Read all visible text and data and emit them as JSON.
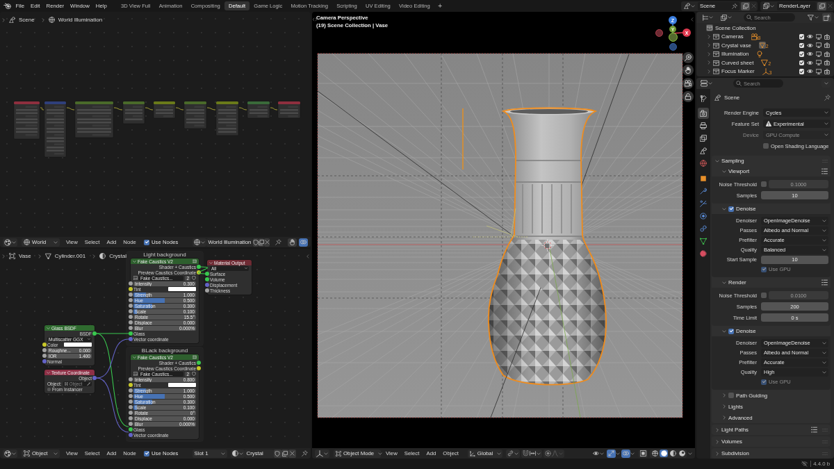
{
  "top_bar": {
    "menus": [
      "File",
      "Edit",
      "Render",
      "Window",
      "Help"
    ],
    "workspaces": [
      {
        "label": "3D View Full",
        "selected": false
      },
      {
        "label": "Animation",
        "selected": false
      },
      {
        "label": "Compositing",
        "selected": false
      },
      {
        "label": "Default",
        "selected": true
      },
      {
        "label": "Game Logic",
        "selected": false
      },
      {
        "label": "Motion Tracking",
        "selected": false
      },
      {
        "label": "Scripting",
        "selected": false
      },
      {
        "label": "UV Editing",
        "selected": false
      },
      {
        "label": "Video Editing",
        "selected": false
      }
    ],
    "add_workspace": "+",
    "scene": "Scene",
    "view_layer": "RenderLayer"
  },
  "world_editor": {
    "breadcrumb": [
      {
        "kind": "scene",
        "label": "Scene"
      },
      {
        "kind": "world",
        "label": "World Illumination"
      }
    ],
    "header": {
      "data_type": {
        "kind": "world",
        "label": "World"
      },
      "menus": [
        "View",
        "Select",
        "Add",
        "Node"
      ],
      "use_nodes": {
        "label": "Use Nodes",
        "checked": true
      },
      "datablock": {
        "kind": "world",
        "label": "World Illumination"
      },
      "toggles": [
        {
          "selected": false
        },
        {
          "selected": true
        }
      ]
    }
  },
  "material_editor": {
    "breadcrumb": [
      {
        "kind": "object",
        "label": "Vase"
      },
      {
        "kind": "mesh",
        "label": "Cylinder.001"
      },
      {
        "kind": "material",
        "label": "Crystal"
      }
    ],
    "frames": [
      {
        "label": "Light background",
        "node": {
          "title": "Fake Caustics V2",
          "outputs": [
            {
              "label": "Shader + Caustics",
              "color": "#39c84f"
            },
            {
              "label": "Preview Caustics Coordinate",
              "color": "#c7c729"
            }
          ],
          "image": {
            "name": "Fake Caustics...",
            "users": "2"
          },
          "inputs": [
            {
              "kind": "number",
              "label": "Intensity",
              "value": "0.300",
              "color": "#a1a1a1"
            },
            {
              "kind": "color",
              "label": "Tint",
              "color": "#c7c729"
            },
            {
              "kind": "slider",
              "label": "Strength",
              "value": "1.000",
              "level": 0.2,
              "color": "#a1a1a1"
            },
            {
              "kind": "slider",
              "label": "Hue",
              "value": "0.500",
              "level": 0.5,
              "color": "#a1a1a1"
            },
            {
              "kind": "slider",
              "label": "Saturation",
              "value": "0.300",
              "level": 0.3,
              "color": "#a1a1a1"
            },
            {
              "kind": "slider",
              "label": "Scale",
              "value": "0.100",
              "level": 0.06,
              "color": "#a1a1a1"
            },
            {
              "kind": "number",
              "label": "Rotate",
              "value": "15.5°",
              "color": "#a1a1a1"
            },
            {
              "kind": "number",
              "label": "Displace",
              "value": "0.000",
              "color": "#a1a1a1"
            },
            {
              "kind": "number",
              "label": "Blur",
              "value": "0.000%",
              "color": "#a1a1a1"
            },
            {
              "kind": "socket",
              "label": "Glass",
              "color": "#39c84f"
            },
            {
              "kind": "socket",
              "label": "Vector coordinate",
              "color": "#6363c7"
            }
          ]
        }
      },
      {
        "label": "BLack background",
        "node": {
          "title": "Fake Caustics V2",
          "outputs": [
            {
              "label": "Shader + Caustics",
              "color": "#39c84f"
            },
            {
              "label": "Preview Caustics Coordinate",
              "color": "#c7c729"
            }
          ],
          "image": {
            "name": "Fake Caustics...",
            "users": "2"
          },
          "inputs": [
            {
              "kind": "number",
              "label": "Intensity",
              "value": "0.800",
              "color": "#a1a1a1"
            },
            {
              "kind": "color",
              "label": "Tint",
              "color": "#c7c729"
            },
            {
              "kind": "slider",
              "label": "Strength",
              "value": "1.000",
              "level": 0.2,
              "color": "#a1a1a1"
            },
            {
              "kind": "slider",
              "label": "Hue",
              "value": "0.500",
              "level": 0.5,
              "color": "#a1a1a1"
            },
            {
              "kind": "slider",
              "label": "Saturation",
              "value": "0.300",
              "level": 0.3,
              "color": "#a1a1a1"
            },
            {
              "kind": "slider",
              "label": "Scale",
              "value": "0.100",
              "level": 0.06,
              "color": "#a1a1a1"
            },
            {
              "kind": "number",
              "label": "Rotate",
              "value": "0°",
              "color": "#a1a1a1"
            },
            {
              "kind": "number",
              "label": "Displace",
              "value": "0.000",
              "color": "#a1a1a1"
            },
            {
              "kind": "number",
              "label": "Blur",
              "value": "0.000%",
              "color": "#a1a1a1"
            },
            {
              "kind": "socket",
              "label": "Glass",
              "color": "#39c84f"
            },
            {
              "kind": "socket",
              "label": "Vector coordinate",
              "color": "#6363c7"
            }
          ]
        }
      }
    ],
    "nodes": [
      {
        "kind": "output",
        "title": "Material Output",
        "target": "All",
        "inputs": [
          {
            "kind": "socket",
            "label": "Surface",
            "color": "#39c84f"
          },
          {
            "kind": "socket",
            "label": "Volume",
            "color": "#39c84f"
          },
          {
            "kind": "socket",
            "label": "Displacement",
            "color": "#6363c7"
          },
          {
            "kind": "socket",
            "label": "Thickness",
            "color": "#a1a1a1"
          }
        ]
      },
      {
        "kind": "bsdf",
        "title": "Glass BSDF",
        "outputs": [
          {
            "label": "BSDF",
            "color": "#39c84f"
          }
        ],
        "distribution": "Multiscatter GGX",
        "inputs": [
          {
            "kind": "color",
            "label": "Color",
            "color": "#c7c729"
          },
          {
            "kind": "number",
            "label": "Roughne...",
            "value": "0.000",
            "color": "#a1a1a1"
          },
          {
            "kind": "number",
            "label": "IOR",
            "value": "1.400",
            "color": "#a1a1a1"
          },
          {
            "kind": "socket",
            "label": "Normal",
            "color": "#6363c7"
          }
        ]
      },
      {
        "kind": "texcoord",
        "title": "Texture Coordinate",
        "outputs": [
          {
            "label": "Object",
            "color": "#6363c7"
          }
        ],
        "object_field": {
          "label": "Object:",
          "placeholder": "Object"
        },
        "from_instancer": {
          "label": "From Instancer",
          "checked": false
        }
      }
    ],
    "header": {
      "data_type": {
        "kind": "object",
        "label": "Object"
      },
      "menus": [
        "View",
        "Select",
        "Add",
        "Node"
      ],
      "use_nodes": {
        "label": "Use Nodes",
        "checked": true
      },
      "slot": "Slot 1",
      "datablock": {
        "kind": "material",
        "label": "Crystal"
      }
    }
  },
  "viewport": {
    "view_name": "Camera Perspective",
    "collection_info": "(19) Scene Collection | Vase",
    "gizmo": [
      {
        "label": "Z"
      },
      {
        "label": "Y"
      },
      {
        "label": "X"
      }
    ],
    "header": {
      "mode": "Object Mode",
      "menus": [
        "View",
        "Select",
        "Add",
        "Object"
      ],
      "orientation": "Global",
      "snapping": false,
      "proportional": false,
      "gizmos": true,
      "overlays": true,
      "shading": [
        {
          "kind": "wireframe",
          "selected": false
        },
        {
          "kind": "solid",
          "selected": true
        },
        {
          "kind": "material",
          "selected": false
        },
        {
          "kind": "rendered",
          "selected": false
        }
      ]
    }
  },
  "outliner": {
    "search": {
      "placeholder": "Search"
    },
    "root": "Scene Collection",
    "collections": [
      {
        "name": "Cameras",
        "kind": "camera",
        "count": "3",
        "selected": false,
        "checked": true
      },
      {
        "name": "Crystal vase",
        "kind": "mesh",
        "count": "2",
        "selected": true,
        "checked": true
      },
      {
        "name": "Illumination",
        "kind": "light",
        "selected": false,
        "checked": true
      },
      {
        "name": "Curved sheet",
        "kind": "mesh",
        "count": "2",
        "selected": false,
        "checked": true
      },
      {
        "name": "Focus Marker",
        "kind": "empty",
        "count": "3",
        "selected": false,
        "checked": true
      }
    ]
  },
  "properties": {
    "search": {
      "placeholder": "Search"
    },
    "tabs": [
      {
        "kind": "tool",
        "selected": false
      },
      {
        "kind": "render",
        "selected": true
      },
      {
        "kind": "output",
        "selected": false
      },
      {
        "kind": "view_layer",
        "selected": false
      },
      {
        "kind": "scene",
        "selected": false
      },
      {
        "kind": "world",
        "selected": false
      },
      {
        "kind": "object",
        "selected": false
      },
      {
        "kind": "modifiers",
        "selected": false
      },
      {
        "kind": "particles",
        "selected": false
      },
      {
        "kind": "physics",
        "selected": false
      },
      {
        "kind": "constraints",
        "selected": false
      },
      {
        "kind": "data",
        "selected": false
      },
      {
        "kind": "material",
        "selected": false
      }
    ],
    "context": "Scene",
    "fields": [
      {
        "kind": "dropdown",
        "label": "Render Engine",
        "value": "Cycles",
        "warning": false,
        "disabled": false
      },
      {
        "kind": "dropdown",
        "label": "Feature Set",
        "value": "Experimental",
        "warning": true,
        "disabled": false
      },
      {
        "kind": "dropdown",
        "label": "Device",
        "value": "GPU Compute",
        "warning": false,
        "disabled": true
      },
      {
        "kind": "checkbox",
        "label": "Open Shading Language",
        "checked": false,
        "disabled": false
      }
    ],
    "panels": [
      {
        "title": "Sampling",
        "expanded": true,
        "presets": false,
        "children": [
          {
            "title": "Viewport",
            "expanded": true,
            "presets": true,
            "rows": [
              {
                "kind": "threshold",
                "label": "Noise Threshold",
                "checked": false,
                "value": "0.1000"
              },
              {
                "kind": "number",
                "label": "Samples",
                "value": "10"
              }
            ],
            "children": [
              {
                "title": "Denoise",
                "expanded": true,
                "presets": false,
                "checked": true,
                "rows": [
                  {
                    "kind": "dropdown",
                    "label": "Denoiser",
                    "value": "OpenImageDenoise"
                  },
                  {
                    "kind": "dropdown",
                    "label": "Passes",
                    "value": "Albedo and Normal"
                  },
                  {
                    "kind": "dropdown",
                    "label": "Prefilter",
                    "value": "Accurate"
                  },
                  {
                    "kind": "dropdown",
                    "label": "Quality",
                    "value": "Balanced"
                  },
                  {
                    "kind": "number",
                    "label": "Start Sample",
                    "value": "10"
                  },
                  {
                    "kind": "checkbox",
                    "label": "Use GPU",
                    "checked": true,
                    "disabled": true
                  }
                ]
              }
            ]
          },
          {
            "title": "Render",
            "expanded": true,
            "presets": true,
            "rows": [
              {
                "kind": "threshold",
                "label": "Noise Threshold",
                "checked": false,
                "value": "0.0100"
              },
              {
                "kind": "number",
                "label": "Samples",
                "value": "200"
              },
              {
                "kind": "number",
                "label": "Time Limit",
                "value": "0 s"
              }
            ],
            "children": [
              {
                "title": "Denoise",
                "expanded": true,
                "presets": false,
                "checked": true,
                "rows": [
                  {
                    "kind": "dropdown",
                    "label": "Denoiser",
                    "value": "OpenImageDenoise"
                  },
                  {
                    "kind": "dropdown",
                    "label": "Passes",
                    "value": "Albedo and Normal"
                  },
                  {
                    "kind": "dropdown",
                    "label": "Prefilter",
                    "value": "Accurate"
                  },
                  {
                    "kind": "dropdown",
                    "label": "Quality",
                    "value": "High"
                  },
                  {
                    "kind": "checkbox",
                    "label": "Use GPU",
                    "checked": true,
                    "disabled": true
                  }
                ]
              }
            ]
          },
          {
            "title": "Path Guiding",
            "expanded": false,
            "presets": false,
            "checked": false
          },
          {
            "title": "Lights",
            "expanded": false,
            "presets": false
          },
          {
            "title": "Advanced",
            "expanded": false,
            "presets": false
          }
        ]
      },
      {
        "title": "Light Paths",
        "expanded": false,
        "presets": true
      },
      {
        "title": "Volumes",
        "expanded": false,
        "presets": false
      },
      {
        "title": "Subdivision",
        "expanded": false,
        "presets": false
      }
    ]
  },
  "status_bar": {
    "version": "4.4.0 b"
  }
}
